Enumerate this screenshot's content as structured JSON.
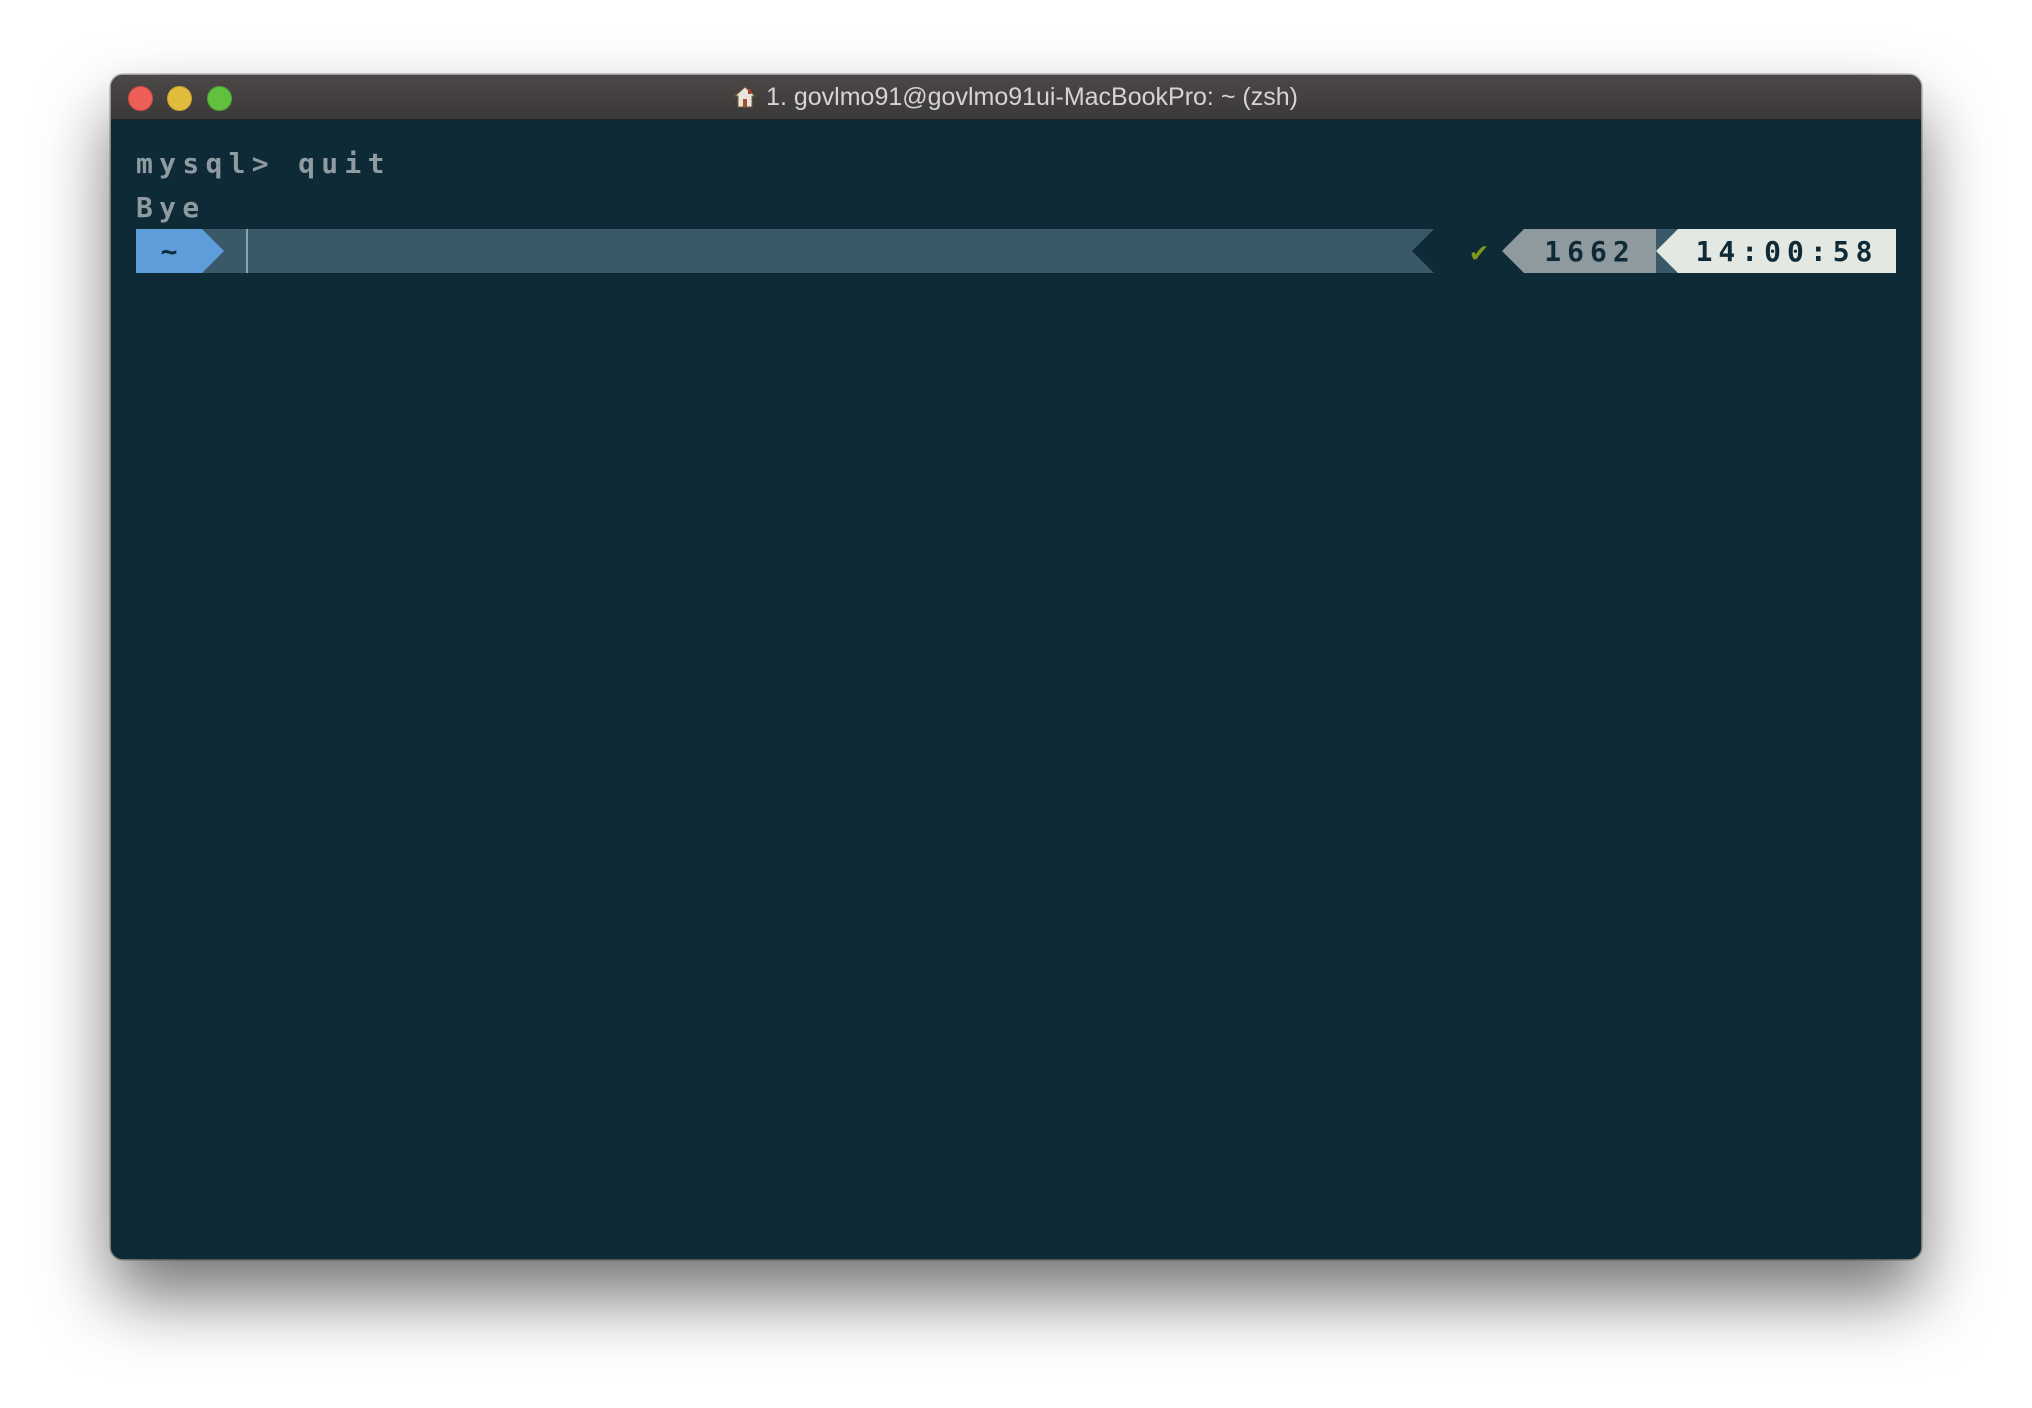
{
  "window": {
    "title": "1. govlmo91@govlmo91ui-MacBookPro: ~ (zsh)",
    "title_icon": "home-icon"
  },
  "terminal": {
    "lines": [
      "mysql> quit",
      "Bye"
    ]
  },
  "prompt": {
    "directory": "~",
    "status_symbol": "✔",
    "history_number": "1662",
    "time": "14:00:58"
  },
  "colors": {
    "terminal_background": "#0f2a37",
    "directory_segment": "#5d9dd9",
    "prompt_bar": "#3a5968",
    "status_ok": "#7d9a16",
    "history_segment": "#8f9a9e",
    "time_segment": "#e3e8e3",
    "close_button": "#ec5f56",
    "minimize_button": "#e1bc3c",
    "zoom_button": "#62c03f"
  }
}
